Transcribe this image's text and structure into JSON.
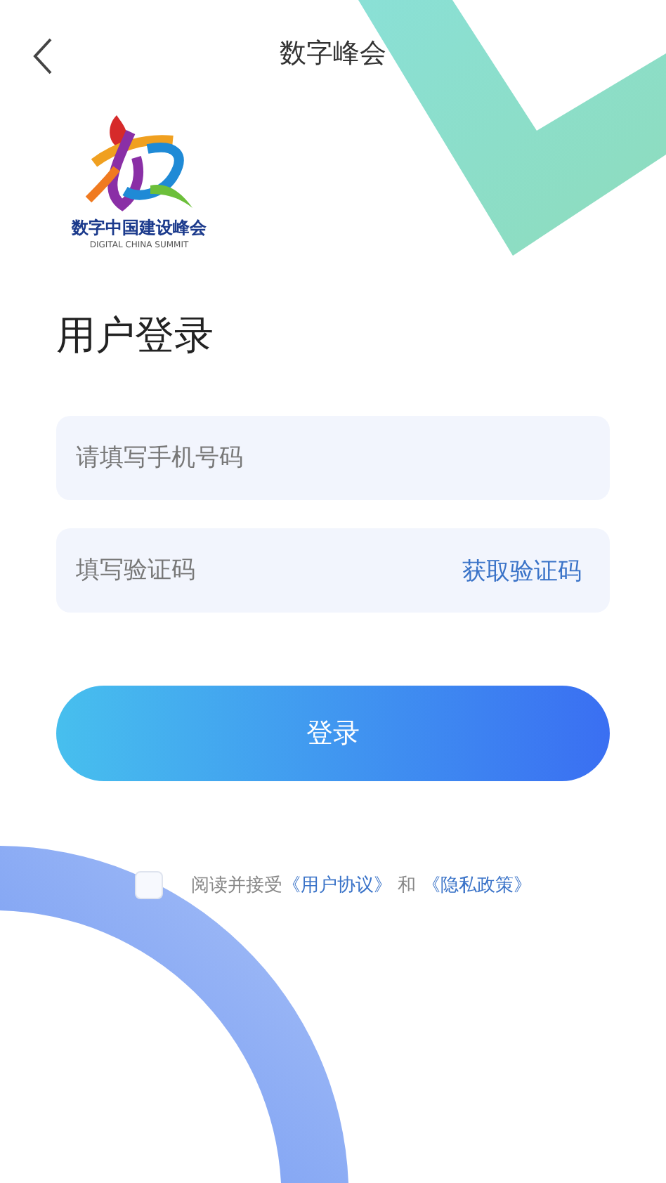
{
  "header": {
    "title": "数字峰会"
  },
  "logo": {
    "name_cn": "数字中国建设峰会",
    "name_en": "DIGITAL CHINA SUMMIT"
  },
  "heading": "用户登录",
  "fields": [
    {
      "kind": "phone",
      "placeholder": "请填写手机号码"
    },
    {
      "kind": "code",
      "placeholder": "填写验证码",
      "action": "获取验证码"
    }
  ],
  "login_button": "登录",
  "agreement": {
    "checked": false,
    "text": "阅读并接受",
    "link1": "《用户协议》",
    "joiner": "和",
    "link2": "《隐私政策》"
  }
}
